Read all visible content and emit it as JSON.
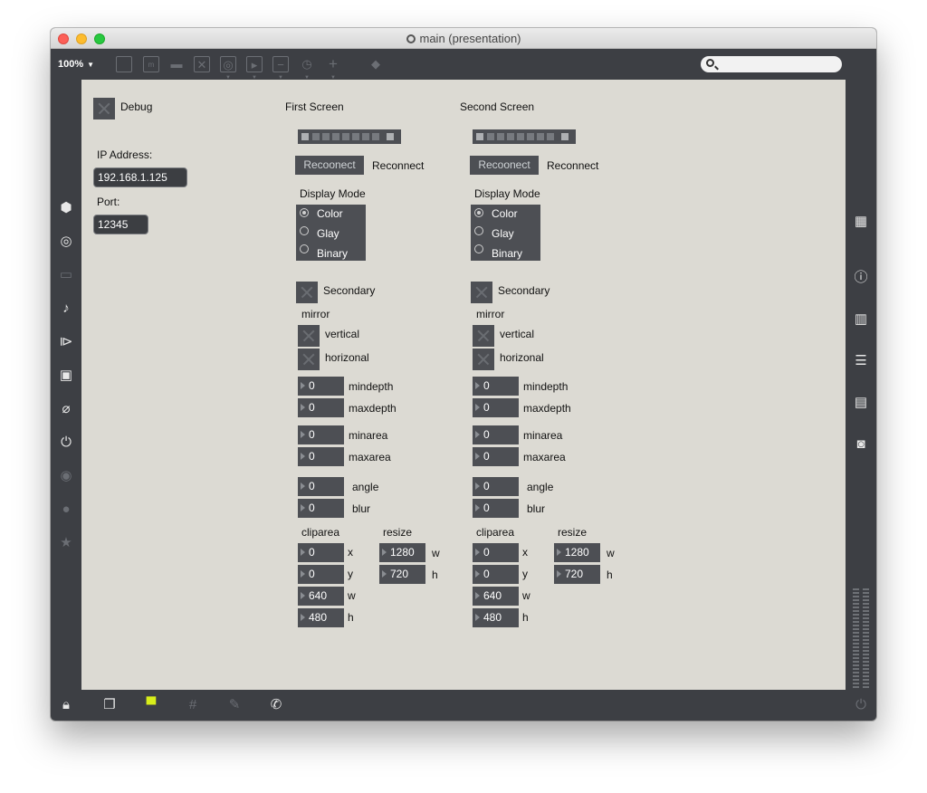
{
  "window": {
    "title": "main (presentation)",
    "zoom": "100%"
  },
  "debug": {
    "label": "Debug"
  },
  "network": {
    "ip_label": "IP Address:",
    "ip_value": "192.168.1.125",
    "port_label": "Port:",
    "port_value": "12345"
  },
  "screens": [
    {
      "title": "First Screen",
      "reconnect_button": "Recoonect",
      "reconnect_label": "Reconnect",
      "display_mode_label": "Display Mode",
      "display_modes": [
        "Color",
        "Glay",
        "Binary"
      ],
      "selected_mode": "Color",
      "secondary_label": "Secondary",
      "mirror_label": "mirror",
      "vertical_label": "vertical",
      "horizontal_label": "horizonal",
      "mindepth": {
        "label": "mindepth",
        "value": "0"
      },
      "maxdepth": {
        "label": "maxdepth",
        "value": "0"
      },
      "minarea": {
        "label": "minarea",
        "value": "0"
      },
      "maxarea": {
        "label": "maxarea",
        "value": "0"
      },
      "angle": {
        "label": "angle",
        "value": "0"
      },
      "blur": {
        "label": "blur",
        "value": "0"
      },
      "cliparea_label": "cliparea",
      "clip_x": {
        "label": "x",
        "value": "0"
      },
      "clip_y": {
        "label": "y",
        "value": "0"
      },
      "clip_w": {
        "label": "w",
        "value": "640"
      },
      "clip_h": {
        "label": "h",
        "value": "480"
      },
      "resize_label": "resize",
      "resize_w": {
        "label": "w",
        "value": "1280"
      },
      "resize_h": {
        "label": "h",
        "value": "720"
      }
    },
    {
      "title": "Second Screen",
      "reconnect_button": "Recoonect",
      "reconnect_label": "Reconnect",
      "display_mode_label": "Display Mode",
      "display_modes": [
        "Color",
        "Glay",
        "Binary"
      ],
      "selected_mode": "Color",
      "secondary_label": "Secondary",
      "mirror_label": "mirror",
      "vertical_label": "vertical",
      "horizontal_label": "horizonal",
      "mindepth": {
        "label": "mindepth",
        "value": "0"
      },
      "maxdepth": {
        "label": "maxdepth",
        "value": "0"
      },
      "minarea": {
        "label": "minarea",
        "value": "0"
      },
      "maxarea": {
        "label": "maxarea",
        "value": "0"
      },
      "angle": {
        "label": "angle",
        "value": "0"
      },
      "blur": {
        "label": "blur",
        "value": "0"
      },
      "cliparea_label": "cliparea",
      "clip_x": {
        "label": "x",
        "value": "0"
      },
      "clip_y": {
        "label": "y",
        "value": "0"
      },
      "clip_w": {
        "label": "w",
        "value": "640"
      },
      "clip_h": {
        "label": "h",
        "value": "480"
      },
      "resize_label": "resize",
      "resize_w": {
        "label": "w",
        "value": "1280"
      },
      "resize_h": {
        "label": "h",
        "value": "720"
      }
    }
  ],
  "colors": {
    "canvas_bg": "#dcdad3",
    "chrome": "#3d3f44",
    "widget": "#4d4f54",
    "active_accent": "#d8ee1a"
  }
}
